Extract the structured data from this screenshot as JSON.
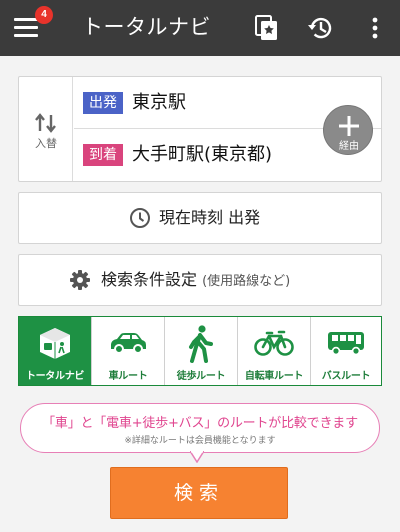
{
  "header": {
    "title": "トータルナビ",
    "badge_count": "4",
    "bg_color": "#3b3b3b"
  },
  "route": {
    "swap_label": "入替",
    "departure_tag": "出発",
    "departure_station": "東京駅",
    "arrival_tag": "到着",
    "arrival_station": "大手町駅(東京都)",
    "via_label": "経由"
  },
  "time_button": {
    "label": "現在時刻 出発"
  },
  "conditions_button": {
    "label": "検索条件設定",
    "sub_label": "(使用路線など)"
  },
  "modes": [
    {
      "label": "トータルナビ",
      "icon": "total-navi-icon",
      "active": true
    },
    {
      "label": "車ルート",
      "icon": "car-icon",
      "active": false
    },
    {
      "label": "徒歩ルート",
      "icon": "walking-icon",
      "active": false
    },
    {
      "label": "自転車ルート",
      "icon": "bicycle-icon",
      "active": false
    },
    {
      "label": "バスルート",
      "icon": "bus-icon",
      "active": false
    }
  ],
  "info": {
    "message": "「車」と「電車+徒歩+バス」のルートが比較できます",
    "note": "※詳細なルートは会員機能となります"
  },
  "search_button": {
    "label": "検索"
  },
  "colors": {
    "accent_green": "#1e9144",
    "search_orange": "#f68231",
    "departure_blue": "#4b63c7",
    "arrival_pink": "#d9447d",
    "info_pink": "#e0458f"
  }
}
